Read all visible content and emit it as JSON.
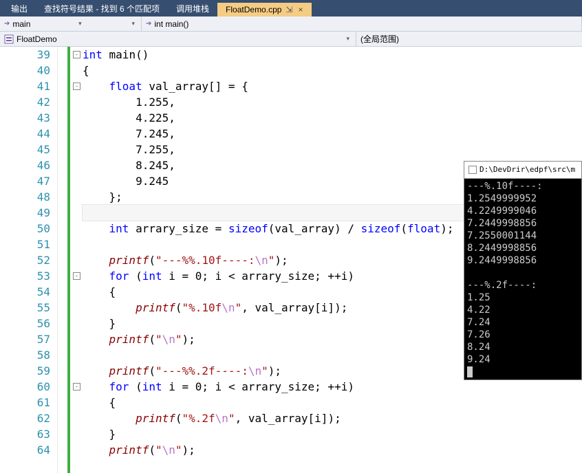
{
  "tabs": [
    {
      "label": "输出",
      "active": false
    },
    {
      "label": "查找符号结果 - 找到 6 个匹配项",
      "active": false
    },
    {
      "label": "调用堆栈",
      "active": false
    },
    {
      "label": "FloatDemo.cpp",
      "active": true
    }
  ],
  "nav": {
    "scope": "main",
    "func": "int main()"
  },
  "classbar": {
    "file": "FloatDemo",
    "scope": "(全局范围)"
  },
  "gutter": {
    "start": 39,
    "end": 64
  },
  "code_lines": [
    {
      "fold": "-",
      "tokens": [
        {
          "t": "kw",
          "s": "int"
        },
        {
          "t": "",
          "s": " main()"
        }
      ]
    },
    {
      "tokens": [
        {
          "t": "",
          "s": "{"
        }
      ]
    },
    {
      "fold": "-",
      "tokens": [
        {
          "t": "",
          "s": "    "
        },
        {
          "t": "kw",
          "s": "float"
        },
        {
          "t": "",
          "s": " val_array[] = {"
        }
      ]
    },
    {
      "tokens": [
        {
          "t": "",
          "s": "        1.255,"
        }
      ]
    },
    {
      "tokens": [
        {
          "t": "",
          "s": "        4.225,"
        }
      ]
    },
    {
      "tokens": [
        {
          "t": "",
          "s": "        7.245,"
        }
      ]
    },
    {
      "tokens": [
        {
          "t": "",
          "s": "        7.255,"
        }
      ]
    },
    {
      "tokens": [
        {
          "t": "",
          "s": "        8.245,"
        }
      ]
    },
    {
      "tokens": [
        {
          "t": "",
          "s": "        9.245"
        }
      ]
    },
    {
      "tokens": [
        {
          "t": "",
          "s": "    };"
        }
      ]
    },
    {
      "hl": true,
      "tokens": [
        {
          "t": "",
          "s": ""
        }
      ]
    },
    {
      "tokens": [
        {
          "t": "",
          "s": "    "
        },
        {
          "t": "kw",
          "s": "int"
        },
        {
          "t": "",
          "s": " arrary_size = "
        },
        {
          "t": "kw",
          "s": "sizeof"
        },
        {
          "t": "",
          "s": "(val_array) / "
        },
        {
          "t": "kw",
          "s": "sizeof"
        },
        {
          "t": "",
          "s": "("
        },
        {
          "t": "kw",
          "s": "float"
        },
        {
          "t": "",
          "s": ");"
        }
      ]
    },
    {
      "tokens": [
        {
          "t": "",
          "s": ""
        }
      ]
    },
    {
      "tokens": [
        {
          "t": "",
          "s": "    "
        },
        {
          "t": "call",
          "s": "printf"
        },
        {
          "t": "",
          "s": "("
        },
        {
          "t": "str",
          "s": "\"---%%.10f----:"
        },
        {
          "t": "esc",
          "s": "\\n"
        },
        {
          "t": "str",
          "s": "\""
        },
        {
          "t": "",
          "s": ");"
        }
      ]
    },
    {
      "fold": "-",
      "tokens": [
        {
          "t": "",
          "s": "    "
        },
        {
          "t": "kw",
          "s": "for"
        },
        {
          "t": "",
          "s": " ("
        },
        {
          "t": "kw",
          "s": "int"
        },
        {
          "t": "",
          "s": " i = 0; i < arrary_size; ++i)"
        }
      ]
    },
    {
      "tokens": [
        {
          "t": "",
          "s": "    {"
        }
      ]
    },
    {
      "tokens": [
        {
          "t": "",
          "s": "        "
        },
        {
          "t": "call",
          "s": "printf"
        },
        {
          "t": "",
          "s": "("
        },
        {
          "t": "str",
          "s": "\"%.10f"
        },
        {
          "t": "esc",
          "s": "\\n"
        },
        {
          "t": "str",
          "s": "\""
        },
        {
          "t": "",
          "s": ", val_array[i]);"
        }
      ]
    },
    {
      "tokens": [
        {
          "t": "",
          "s": "    }"
        }
      ]
    },
    {
      "tokens": [
        {
          "t": "",
          "s": "    "
        },
        {
          "t": "call",
          "s": "printf"
        },
        {
          "t": "",
          "s": "("
        },
        {
          "t": "str",
          "s": "\""
        },
        {
          "t": "esc",
          "s": "\\n"
        },
        {
          "t": "str",
          "s": "\""
        },
        {
          "t": "",
          "s": ");"
        }
      ]
    },
    {
      "tokens": [
        {
          "t": "",
          "s": ""
        }
      ]
    },
    {
      "tokens": [
        {
          "t": "",
          "s": "    "
        },
        {
          "t": "call",
          "s": "printf"
        },
        {
          "t": "",
          "s": "("
        },
        {
          "t": "str",
          "s": "\"---%%.2f----:"
        },
        {
          "t": "esc",
          "s": "\\n"
        },
        {
          "t": "str",
          "s": "\""
        },
        {
          "t": "",
          "s": ");"
        }
      ]
    },
    {
      "fold": "-",
      "tokens": [
        {
          "t": "",
          "s": "    "
        },
        {
          "t": "kw",
          "s": "for"
        },
        {
          "t": "",
          "s": " ("
        },
        {
          "t": "kw",
          "s": "int"
        },
        {
          "t": "",
          "s": " i = 0; i < arrary_size; ++i)"
        }
      ]
    },
    {
      "tokens": [
        {
          "t": "",
          "s": "    {"
        }
      ]
    },
    {
      "tokens": [
        {
          "t": "",
          "s": "        "
        },
        {
          "t": "call",
          "s": "printf"
        },
        {
          "t": "",
          "s": "("
        },
        {
          "t": "str",
          "s": "\"%.2f"
        },
        {
          "t": "esc",
          "s": "\\n"
        },
        {
          "t": "str",
          "s": "\""
        },
        {
          "t": "",
          "s": ", val_array[i]);"
        }
      ]
    },
    {
      "tokens": [
        {
          "t": "",
          "s": "    }"
        }
      ]
    },
    {
      "tokens": [
        {
          "t": "",
          "s": "    "
        },
        {
          "t": "call",
          "s": "printf"
        },
        {
          "t": "",
          "s": "("
        },
        {
          "t": "str",
          "s": "\""
        },
        {
          "t": "esc",
          "s": "\\n"
        },
        {
          "t": "str",
          "s": "\""
        },
        {
          "t": "",
          "s": ");"
        }
      ]
    }
  ],
  "console": {
    "title": "D:\\DevDrir\\edpf\\src\\m",
    "lines": [
      "---%.10f----:",
      "1.2549999952",
      "4.2249999046",
      "7.2449998856",
      "7.2550001144",
      "8.2449998856",
      "9.2449998856",
      "",
      "---%.2f----:",
      "1.25",
      "4.22",
      "7.24",
      "7.26",
      "8.24",
      "9.24",
      ""
    ]
  },
  "pin_glyph": "⇲",
  "close_glyph": "×"
}
